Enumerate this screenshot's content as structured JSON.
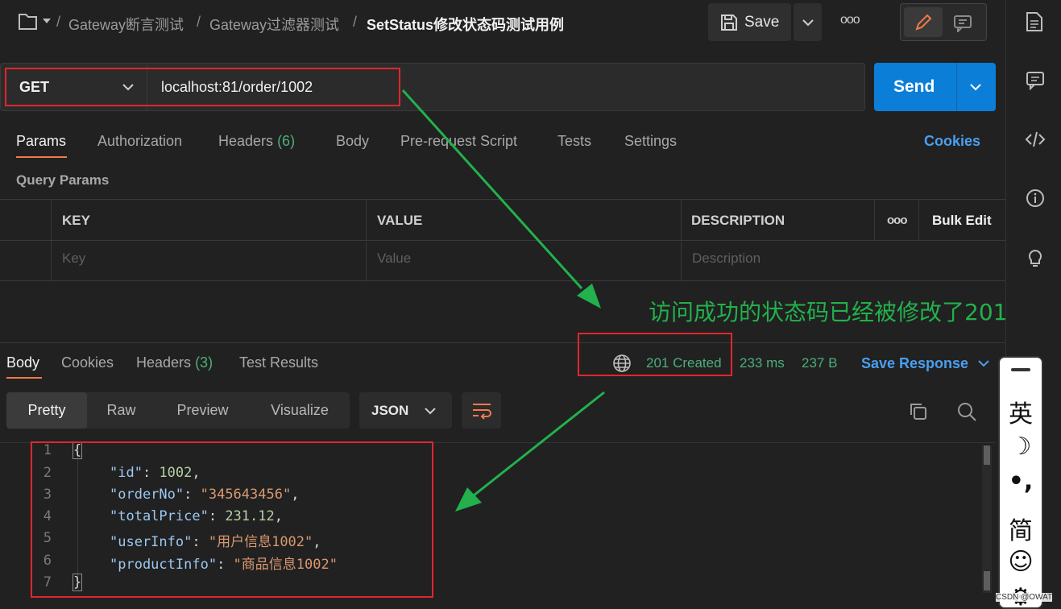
{
  "header": {
    "breadcrumb": [
      "Gateway断言测试",
      "Gateway过滤器测试",
      "SetStatus修改状态码测试用例"
    ],
    "separator": "/",
    "save_label": "Save",
    "more_label": "ooo"
  },
  "request": {
    "method": "GET",
    "url": "localhost:81/order/1002",
    "send_label": "Send"
  },
  "request_tabs": [
    {
      "label": "Params",
      "active": true
    },
    {
      "label": "Authorization"
    },
    {
      "label": "Headers",
      "count": "(6)"
    },
    {
      "label": "Body"
    },
    {
      "label": "Pre-request Script"
    },
    {
      "label": "Tests"
    },
    {
      "label": "Settings"
    }
  ],
  "cookies_label": "Cookies",
  "query_params": {
    "title": "Query Params",
    "columns": [
      "KEY",
      "VALUE",
      "DESCRIPTION"
    ],
    "more_label": "ooo",
    "bulk_edit_label": "Bulk Edit",
    "placeholders": [
      "Key",
      "Value",
      "Description"
    ]
  },
  "annotation": "访问成功的状态码已经被修改了201",
  "response": {
    "tabs": [
      {
        "label": "Body",
        "active": true
      },
      {
        "label": "Cookies"
      },
      {
        "label": "Headers",
        "count": "(3)"
      },
      {
        "label": "Test Results"
      }
    ],
    "status": "201 Created",
    "time": "233 ms",
    "size": "237 B",
    "save_response_label": "Save Response",
    "view_modes": [
      "Pretty",
      "Raw",
      "Preview",
      "Visualize"
    ],
    "format": "JSON",
    "lines": [
      "1",
      "2",
      "3",
      "4",
      "5",
      "6",
      "7"
    ],
    "json": {
      "open": "{",
      "close": "}",
      "fields": [
        {
          "key": "\"id\"",
          "value": "1002",
          "type": "num",
          "comma": ","
        },
        {
          "key": "\"orderNo\"",
          "value": "\"345643456\"",
          "type": "str",
          "comma": ","
        },
        {
          "key": "\"totalPrice\"",
          "value": "231.12",
          "type": "num",
          "comma": ","
        },
        {
          "key": "\"userInfo\"",
          "value": "\"用户信息1002\"",
          "type": "str",
          "comma": ","
        },
        {
          "key": "\"productInfo\"",
          "value": "\"商品信息1002\"",
          "type": "str",
          "comma": ""
        }
      ]
    }
  },
  "ime": {
    "items": [
      "英",
      "☽",
      "•,",
      "简",
      "☺",
      "⚙"
    ]
  },
  "watermark": "CSDN @OWAT",
  "colors": {
    "accent_blue": "#0b7ed8",
    "link_blue": "#4a9ff0",
    "status_green": "#4caf7a",
    "highlight_red": "#e0262e",
    "arrow_green": "#22b14c"
  }
}
